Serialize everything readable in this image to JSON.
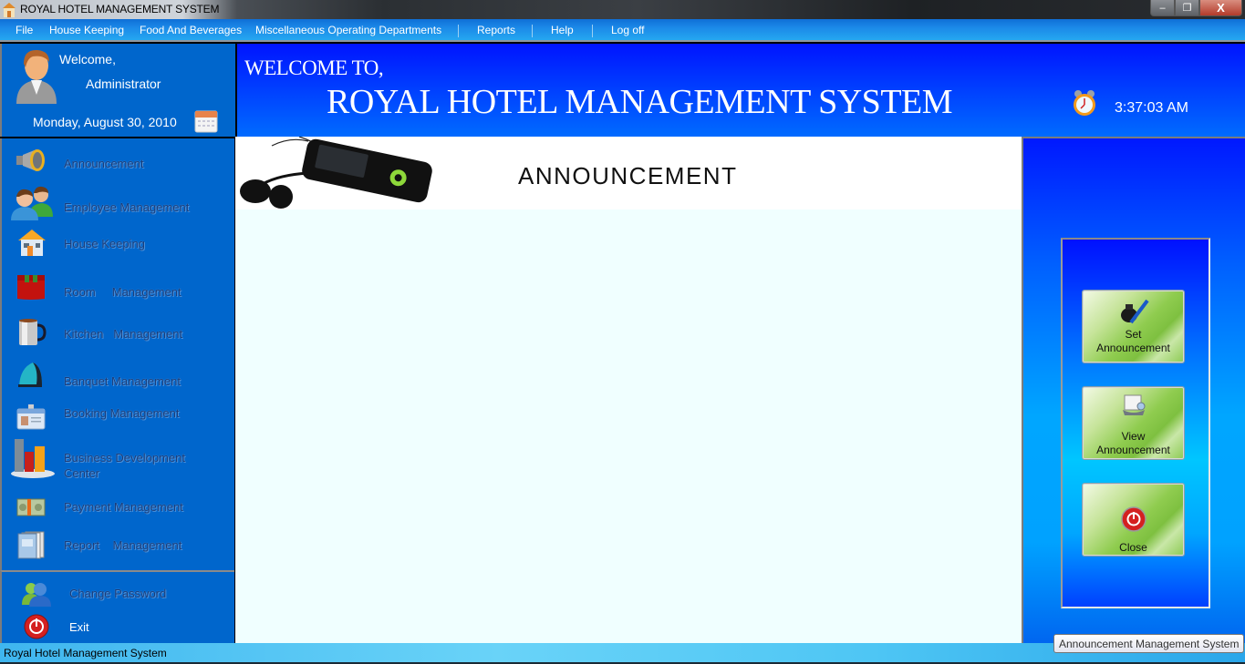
{
  "window": {
    "title": "ROYAL HOTEL MANAGEMENT SYSTEM",
    "icons": {
      "app": "hotel-building-icon",
      "minimize": "minimize-icon",
      "maximize": "restore-icon",
      "close": "close-icon"
    },
    "minimize_glyph": "–",
    "restore_glyph": "❐",
    "close_glyph": "X"
  },
  "menu": {
    "items": [
      {
        "label": "File"
      },
      {
        "label": "House Keeping"
      },
      {
        "label": "Food And Beverages"
      },
      {
        "label": "Miscellaneous Operating Departments"
      },
      {
        "label": "Reports"
      },
      {
        "label": "Help"
      },
      {
        "label": "Log off"
      }
    ]
  },
  "welcome": {
    "greeting": "Welcome,",
    "user": "Administrator",
    "date": "Monday, August 30, 2010",
    "icons": {
      "avatar": "user-avatar-icon",
      "calendar": "calendar-icon"
    }
  },
  "sidebar": {
    "items": [
      {
        "label": "Announcement",
        "icon": "megaphone-icon"
      },
      {
        "label": "Employee Management",
        "icon": "users-icon"
      },
      {
        "label": "House Keeping",
        "icon": "house-icon"
      },
      {
        "label": "Room     Management",
        "icon": "room-curtain-icon"
      },
      {
        "label": "Kitchen   Management",
        "icon": "mug-icon"
      },
      {
        "label": "Banquet Management",
        "icon": "iron-icon"
      },
      {
        "label": "Booking Management",
        "icon": "id-card-icon"
      },
      {
        "label": "Business Development\nCenter",
        "icon": "bar-chart-icon"
      },
      {
        "label": "Payment Management",
        "icon": "money-icon"
      },
      {
        "label": "Report    Management",
        "icon": "report-book-icon"
      }
    ],
    "bottom": [
      {
        "label": "Change Password",
        "icon": "change-password-users-icon"
      },
      {
        "label": "Exit",
        "icon": "power-icon"
      }
    ]
  },
  "banner": {
    "line1": "WELCOME TO,",
    "line2": "ROYAL HOTEL MANAGEMENT SYSTEM",
    "time": "3:37:03 AM",
    "icons": {
      "clock": "alarm-clock-icon"
    }
  },
  "content": {
    "title": "ANNOUNCEMENT",
    "image": "mp3-player-earphones-image"
  },
  "actions": {
    "set": {
      "label_line1": "Set",
      "label_line2": "Announcement",
      "icon": "ink-pen-icon"
    },
    "view": {
      "label_line1": "View",
      "label_line2": "Announcement",
      "icon": "rolodex-icon"
    },
    "close": {
      "label": "Close",
      "icon": "power-icon"
    }
  },
  "tooltip": "Announcement Management System",
  "status": {
    "text": "Royal Hotel Management System"
  },
  "colors": {
    "sidebar_bg": "#0066cc",
    "banner_top": "#0014ff",
    "content_bg": "#f0ffff",
    "tile_green": "#8fcc4f",
    "menu_blue": "#1b89e8"
  }
}
